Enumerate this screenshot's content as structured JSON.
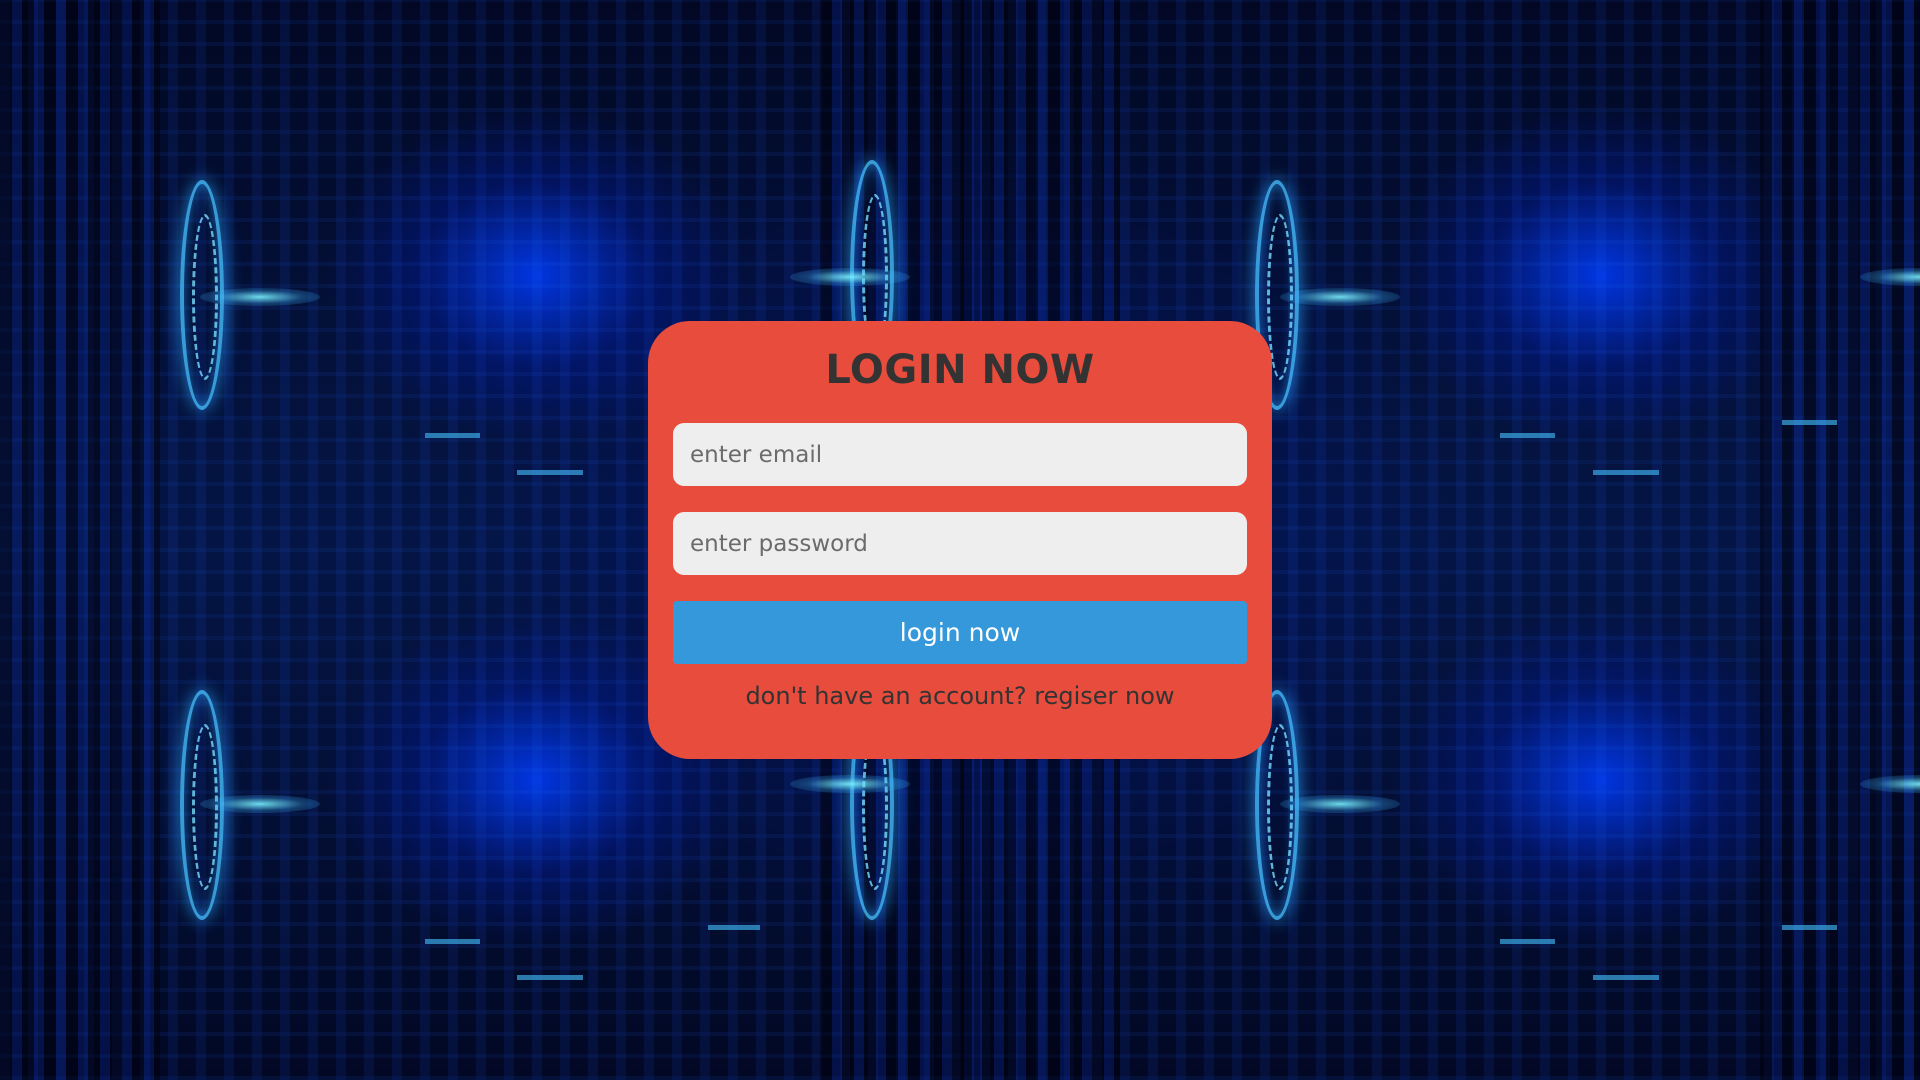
{
  "login": {
    "title": "LOGIN NOW",
    "email_placeholder": "enter email",
    "password_placeholder": "enter password",
    "submit_label": "login now",
    "footer_prompt": "don't have an account?",
    "register_link": "regiser now"
  },
  "colors": {
    "card_background": "#e74c3c",
    "input_background": "#eeeeee",
    "button_background": "#3498db",
    "button_text": "#ffffff",
    "text_dark": "#333333",
    "page_background": "#020a2a"
  }
}
